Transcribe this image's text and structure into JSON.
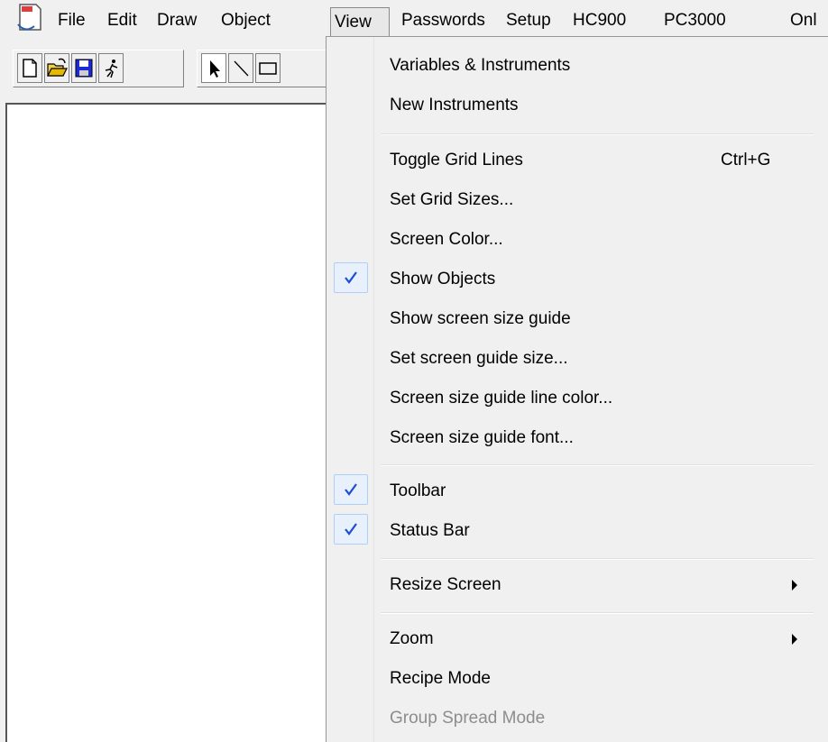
{
  "menubar": {
    "items": [
      {
        "label": "File"
      },
      {
        "label": "Edit"
      },
      {
        "label": "Draw"
      },
      {
        "label": "Object"
      },
      {
        "label": "View"
      },
      {
        "label": "Passwords"
      },
      {
        "label": "Setup"
      },
      {
        "label": "HC900"
      },
      {
        "label": "PC3000"
      },
      {
        "label": "Onl"
      }
    ],
    "open_menu": "View"
  },
  "toolbar": {
    "buttons": [
      {
        "icon": "new-document-icon"
      },
      {
        "icon": "open-folder-icon"
      },
      {
        "icon": "save-disk-icon"
      },
      {
        "icon": "run-icon"
      },
      {
        "icon": "select-arrow-icon",
        "pressed": true
      },
      {
        "icon": "line-tool-icon"
      },
      {
        "icon": "rectangle-tool-icon"
      }
    ]
  },
  "view_menu": {
    "items": [
      {
        "label": "Variables & Instruments"
      },
      {
        "label": "New Instruments"
      },
      {
        "label": "Toggle Grid Lines",
        "shortcut": "Ctrl+G"
      },
      {
        "label": "Set Grid Sizes..."
      },
      {
        "label": "Screen Color..."
      },
      {
        "label": "Show Objects",
        "checked": true
      },
      {
        "label": "Show screen size guide"
      },
      {
        "label": "Set screen guide size..."
      },
      {
        "label": "Screen size guide line color..."
      },
      {
        "label": "Screen size guide font..."
      },
      {
        "label": "Toolbar",
        "checked": true
      },
      {
        "label": "Status Bar",
        "checked": true
      },
      {
        "label": "Resize Screen",
        "submenu": true
      },
      {
        "label": "Zoom",
        "submenu": true
      },
      {
        "label": "Recipe Mode"
      },
      {
        "label": "Group Spread Mode",
        "disabled": true
      }
    ]
  },
  "colors": {
    "menu_background": "#f0f0f0",
    "check_color": "#1c4fd1",
    "disabled_text": "#8d8d8d"
  }
}
